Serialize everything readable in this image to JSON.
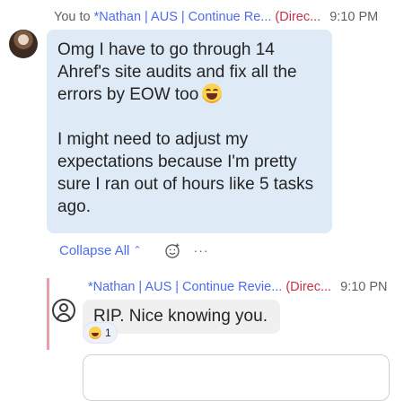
{
  "message1": {
    "header_to": "You to",
    "header_channel": "*Nathan | AUS | Continue Re...",
    "header_external": "(Direc...",
    "header_time": "9:10 PM",
    "text_line1": "Omg I have to go through 14 Ahref's site audits and fix all the errors by EOW too",
    "text_line2": "I might need to adjust my expectations because I'm pretty sure I ran out of hours like 5 tasks ago."
  },
  "actions": {
    "collapse_label": "Collapse All",
    "more_label": "···"
  },
  "reply": {
    "header_channel": "*Nathan | AUS | Continue Revie...",
    "header_external": "(Direc...",
    "header_time": "9:10 PN",
    "text": "RIP. Nice knowing you."
  },
  "reaction": {
    "count": "1"
  },
  "icons": {
    "avatar1": "user-avatar-photo",
    "reaction_emoji": "laughing-face-icon",
    "react": "add-reaction-icon",
    "more": "more-options-icon",
    "collapse": "chevron-up-icon",
    "avatar2": "user-outline-avatar-icon"
  },
  "colors": {
    "accent": "#4f6bed",
    "external": "#c4314b",
    "bubble_self": "#dfeaf7",
    "bubble_other": "#f0f0f0",
    "thread_line": "#e8a0a8"
  }
}
